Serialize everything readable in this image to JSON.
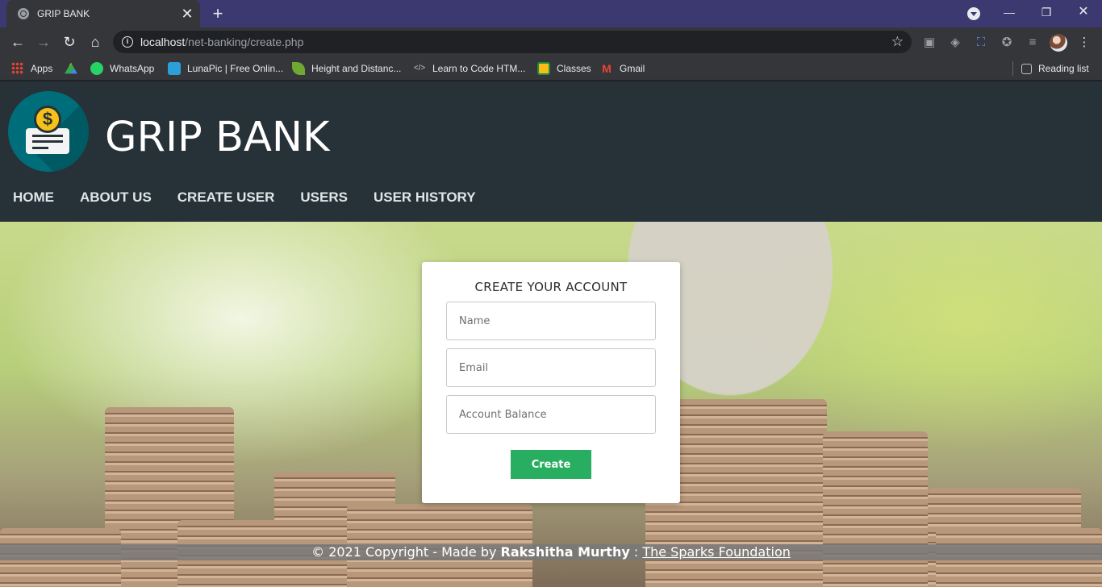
{
  "browser": {
    "tab_title": "GRIP BANK",
    "tab_close": "✕",
    "new_tab": "+",
    "url_host": "localhost",
    "url_path": "/net-banking/create.php",
    "bookmarks": [
      {
        "label": "Apps",
        "icon": "apps-grid-icon"
      },
      {
        "label": "",
        "icon": "google-drive-icon"
      },
      {
        "label": "WhatsApp",
        "icon": "whatsapp-icon"
      },
      {
        "label": "LunaPic | Free Onlin...",
        "icon": "lunapic-icon"
      },
      {
        "label": "Height and Distanc...",
        "icon": "leaf-icon"
      },
      {
        "label": "Learn to Code HTM...",
        "icon": "code-icon"
      },
      {
        "label": "Classes",
        "icon": "classroom-icon"
      },
      {
        "label": "Gmail",
        "icon": "gmail-icon"
      }
    ],
    "reading_list": "Reading list"
  },
  "site": {
    "brand": "GRIP BANK",
    "nav": [
      "HOME",
      "ABOUT US",
      "CREATE USER",
      "USERS",
      "USER HISTORY"
    ]
  },
  "form": {
    "title": "CREATE YOUR ACCOUNT",
    "name_placeholder": "Name",
    "email_placeholder": "Email",
    "balance_placeholder": "Account Balance",
    "submit_label": "Create"
  },
  "footer": {
    "prefix": "© 2021 Copyright - Made by ",
    "author": "Rakshitha Murthy",
    "separator": " : ",
    "org": "The Sparks Foundation"
  },
  "colors": {
    "header_bg": "#263238",
    "button_green": "#27ae60",
    "tabstrip": "#3c3970"
  }
}
